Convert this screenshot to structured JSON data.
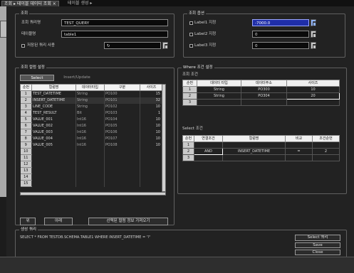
{
  "tabs": [
    {
      "label": "조회 ▸ 테이블 데이터 조회 ×",
      "active": true
    },
    {
      "label": "테이블 생성 ▸",
      "active": false
    }
  ],
  "query_info": {
    "title": "조회",
    "query_name_label": "조회 쿼리명",
    "query_name_value": "TEST_QUERY",
    "table_name_label": "테이블명",
    "table_name_value": "table1",
    "saved_query_label": "저장된 쿼리 사용",
    "saved_query_value": "",
    "option_title": "조회 옵션",
    "options": [
      {
        "label": "Label1 지정",
        "value": "-7000.0",
        "highlight": true
      },
      {
        "label": "Label2 지정",
        "value": "0",
        "highlight": false
      },
      {
        "label": "Label3 지정",
        "value": "0",
        "highlight": false
      }
    ]
  },
  "columns_panel": {
    "title": "조회 컬럼 설정",
    "subtabs": [
      "Select",
      "Insert/Update"
    ],
    "headers": [
      "순번",
      "컬럼명",
      "데이터타입",
      "구분",
      "사이즈"
    ],
    "rows": [
      {
        "num": "1",
        "name": "TEST_DATETIME",
        "type": "String",
        "tag": "PO100",
        "size": "15"
      },
      {
        "num": "2",
        "name": "INSERT_DATETIME",
        "type": "String",
        "tag": "PO101",
        "size": "32"
      },
      {
        "num": "3",
        "name": "LINE_CODE",
        "type": "String",
        "tag": "PO102",
        "size": "10"
      },
      {
        "num": "4",
        "name": "TEST_RESULT",
        "type": "Bit",
        "tag": "PO103",
        "size": "1"
      },
      {
        "num": "5",
        "name": "VALUE_001",
        "type": "Int16",
        "tag": "PO104",
        "size": "10"
      },
      {
        "num": "6",
        "name": "VALUE_002",
        "type": "Int16",
        "tag": "PO105",
        "size": "10"
      },
      {
        "num": "7",
        "name": "VALUE_003",
        "type": "Int16",
        "tag": "PO106",
        "size": "10"
      },
      {
        "num": "8",
        "name": "VALUE_004",
        "type": "Int16",
        "tag": "PO107",
        "size": "10"
      },
      {
        "num": "9",
        "name": "VALUE_005",
        "type": "Int16",
        "tag": "PO108",
        "size": "10"
      },
      {
        "num": "10",
        "name": "",
        "type": "",
        "tag": "",
        "size": ""
      },
      {
        "num": "11",
        "name": "",
        "type": "",
        "tag": "",
        "size": ""
      },
      {
        "num": "12",
        "name": "",
        "type": "",
        "tag": "",
        "size": ""
      },
      {
        "num": "13",
        "name": "",
        "type": "",
        "tag": "",
        "size": ""
      },
      {
        "num": "14",
        "name": "",
        "type": "",
        "tag": "",
        "size": ""
      },
      {
        "num": "15",
        "name": "",
        "type": "",
        "tag": "",
        "size": ""
      }
    ],
    "btn_up": "위",
    "btn_down": "아래",
    "btn_load": "선택된 컬럼 정보 가져오기"
  },
  "where_panel": {
    "title": "Where 조건 설정",
    "sub_title": "조회 조건",
    "headers": [
      "순번",
      "데이터 타입",
      "데이터주소",
      "사이즈"
    ],
    "rows": [
      {
        "num": "1",
        "type": "String",
        "addr": "PO300",
        "size": "10"
      },
      {
        "num": "2",
        "type": "String",
        "addr": "PO304",
        "size": "20"
      },
      {
        "num": "3",
        "type": "",
        "addr": "",
        "size": ""
      }
    ],
    "cond_title": "Select 조건",
    "cond_headers": [
      "순번",
      "연결조건",
      "컬럼명",
      "비교",
      "조건순번"
    ],
    "cond_rows": [
      {
        "num": "1",
        "conn": "",
        "col": "",
        "op": "",
        "idx": ""
      },
      {
        "num": "2",
        "conn": "AND",
        "col": "INSERT_DATETIME",
        "op": "=",
        "idx": "2"
      },
      {
        "num": "3",
        "conn": "",
        "col": "",
        "op": "",
        "idx": ""
      }
    ]
  },
  "query_panel": {
    "title": "생성 쿼리",
    "text": "SELECT * FROM TESTDB.SCHEMA.TABLE1 WHERE INSERT_DATETIME = '?'",
    "btn_run": "Select 쿼리",
    "btn_save": "Save",
    "btn_close": "Close"
  }
}
